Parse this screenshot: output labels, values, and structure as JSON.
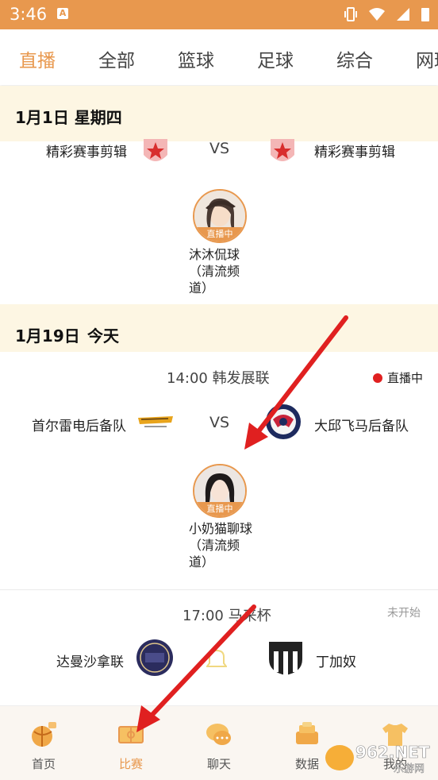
{
  "status_bar": {
    "time": "3:46",
    "badge": "A"
  },
  "tabs": [
    {
      "label": "直播",
      "active": true
    },
    {
      "label": "全部"
    },
    {
      "label": "篮球"
    },
    {
      "label": "足球"
    },
    {
      "label": "综合"
    },
    {
      "label": "网球"
    }
  ],
  "sections": {
    "day1": {
      "date": "1月1日  星期四"
    },
    "day2": {
      "date": "1月19日",
      "today": "今天"
    }
  },
  "match1": {
    "home": "精彩赛事剪辑",
    "away": "精彩赛事剪辑",
    "vs": "VS",
    "host_name": "沐沐侃球（清流频道）",
    "live_badge": "直播中"
  },
  "match2": {
    "time_league": "14:00  韩发展联",
    "status": "直播中",
    "home": "首尔雷电后备队",
    "away": "大邱飞马后备队",
    "vs": "VS",
    "host_name": "小奶猫聊球（清流频道）",
    "live_badge": "直播中"
  },
  "match3": {
    "time_league": "17:00  马来杯",
    "status": "未开始",
    "home": "达曼沙拿联",
    "away": "丁加奴"
  },
  "bottom_nav": [
    {
      "label": "首页",
      "icon": "home-ball-icon"
    },
    {
      "label": "比赛",
      "icon": "match-field-icon",
      "active": true
    },
    {
      "label": "聊天",
      "icon": "chat-bubble-icon"
    },
    {
      "label": "数据",
      "icon": "data-trophy-icon"
    },
    {
      "label": "我的",
      "icon": "jersey-icon"
    }
  ],
  "watermark": {
    "text": "962.NET",
    "sub": "乐游网"
  },
  "colors": {
    "accent": "#e8984e",
    "live": "#e02020",
    "annotation": "#e02020"
  }
}
